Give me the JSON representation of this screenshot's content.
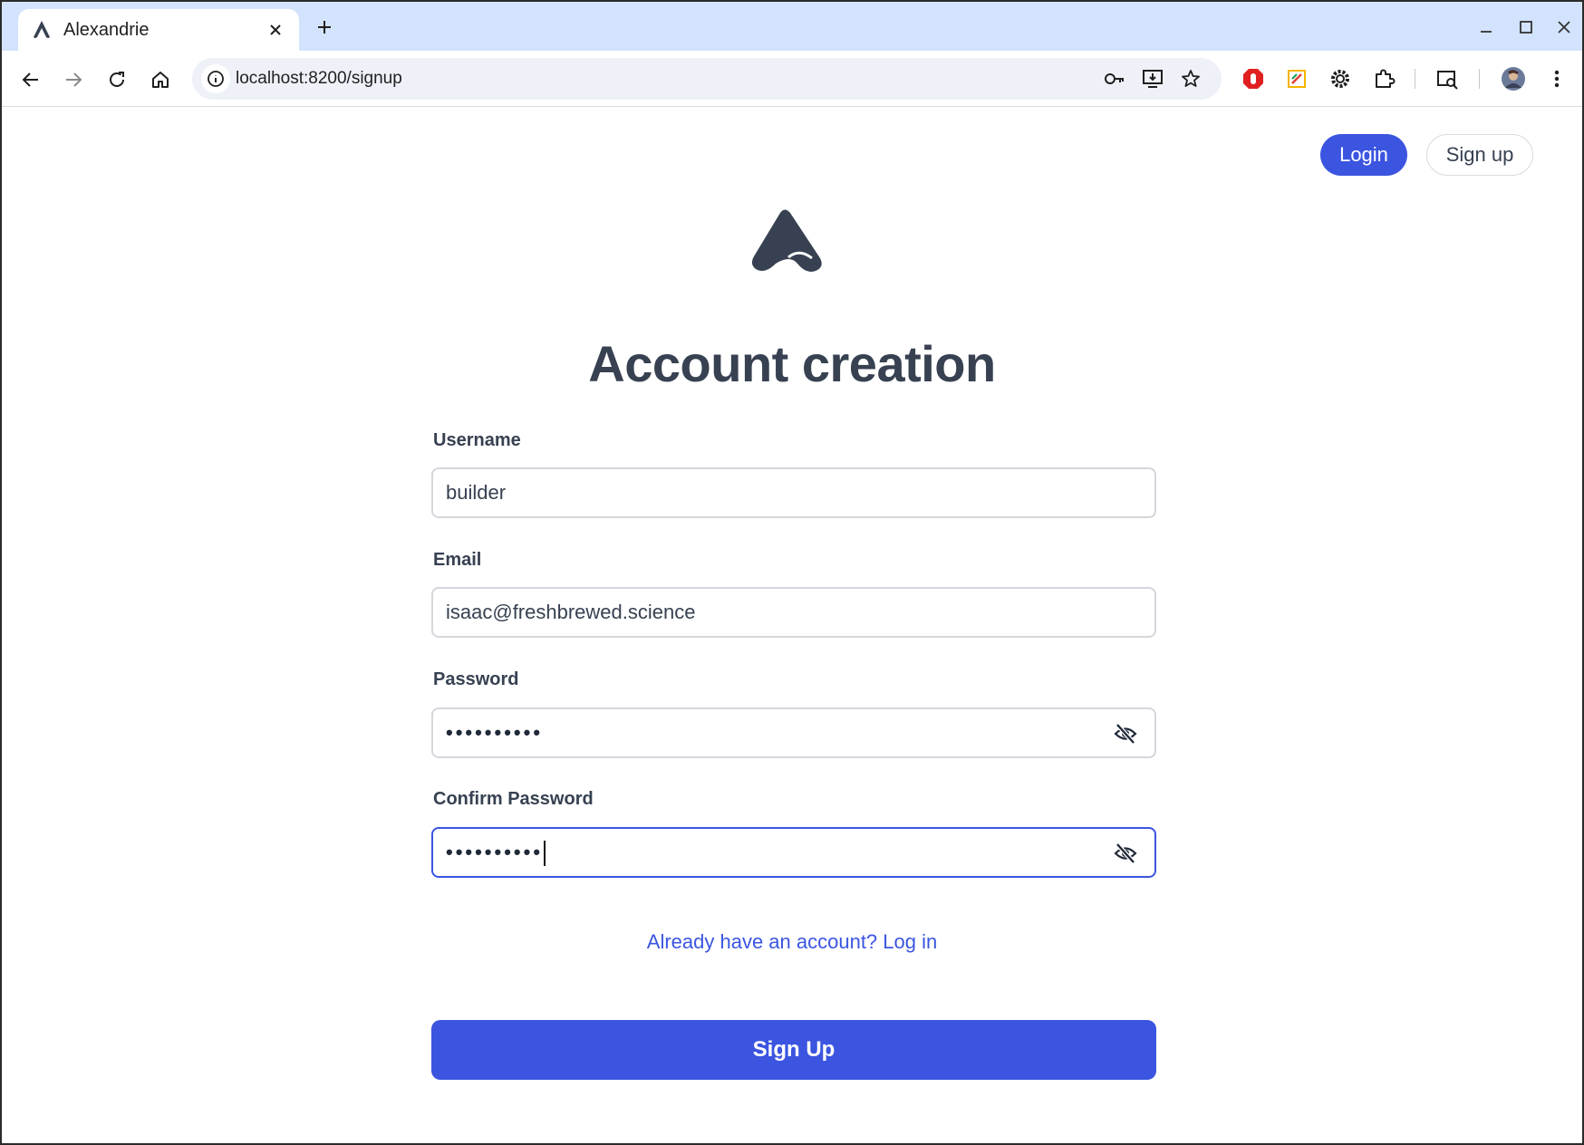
{
  "browser": {
    "tab_title": "Alexandrie",
    "url": "localhost:8200/signup"
  },
  "header": {
    "login_label": "Login",
    "signup_label": "Sign up"
  },
  "form": {
    "title": "Account creation",
    "username_label": "Username",
    "username_value": "builder",
    "email_label": "Email",
    "email_value": "isaac@freshbrewed.science",
    "password_label": "Password",
    "password_masked": "••••••••••",
    "confirm_label": "Confirm Password",
    "confirm_masked": "••••••••••",
    "login_link": "Already have an account? Log in",
    "submit_label": "Sign Up"
  },
  "colors": {
    "accent": "#3b55e0",
    "text": "#374151",
    "tabstrip": "#d3e3fd"
  }
}
